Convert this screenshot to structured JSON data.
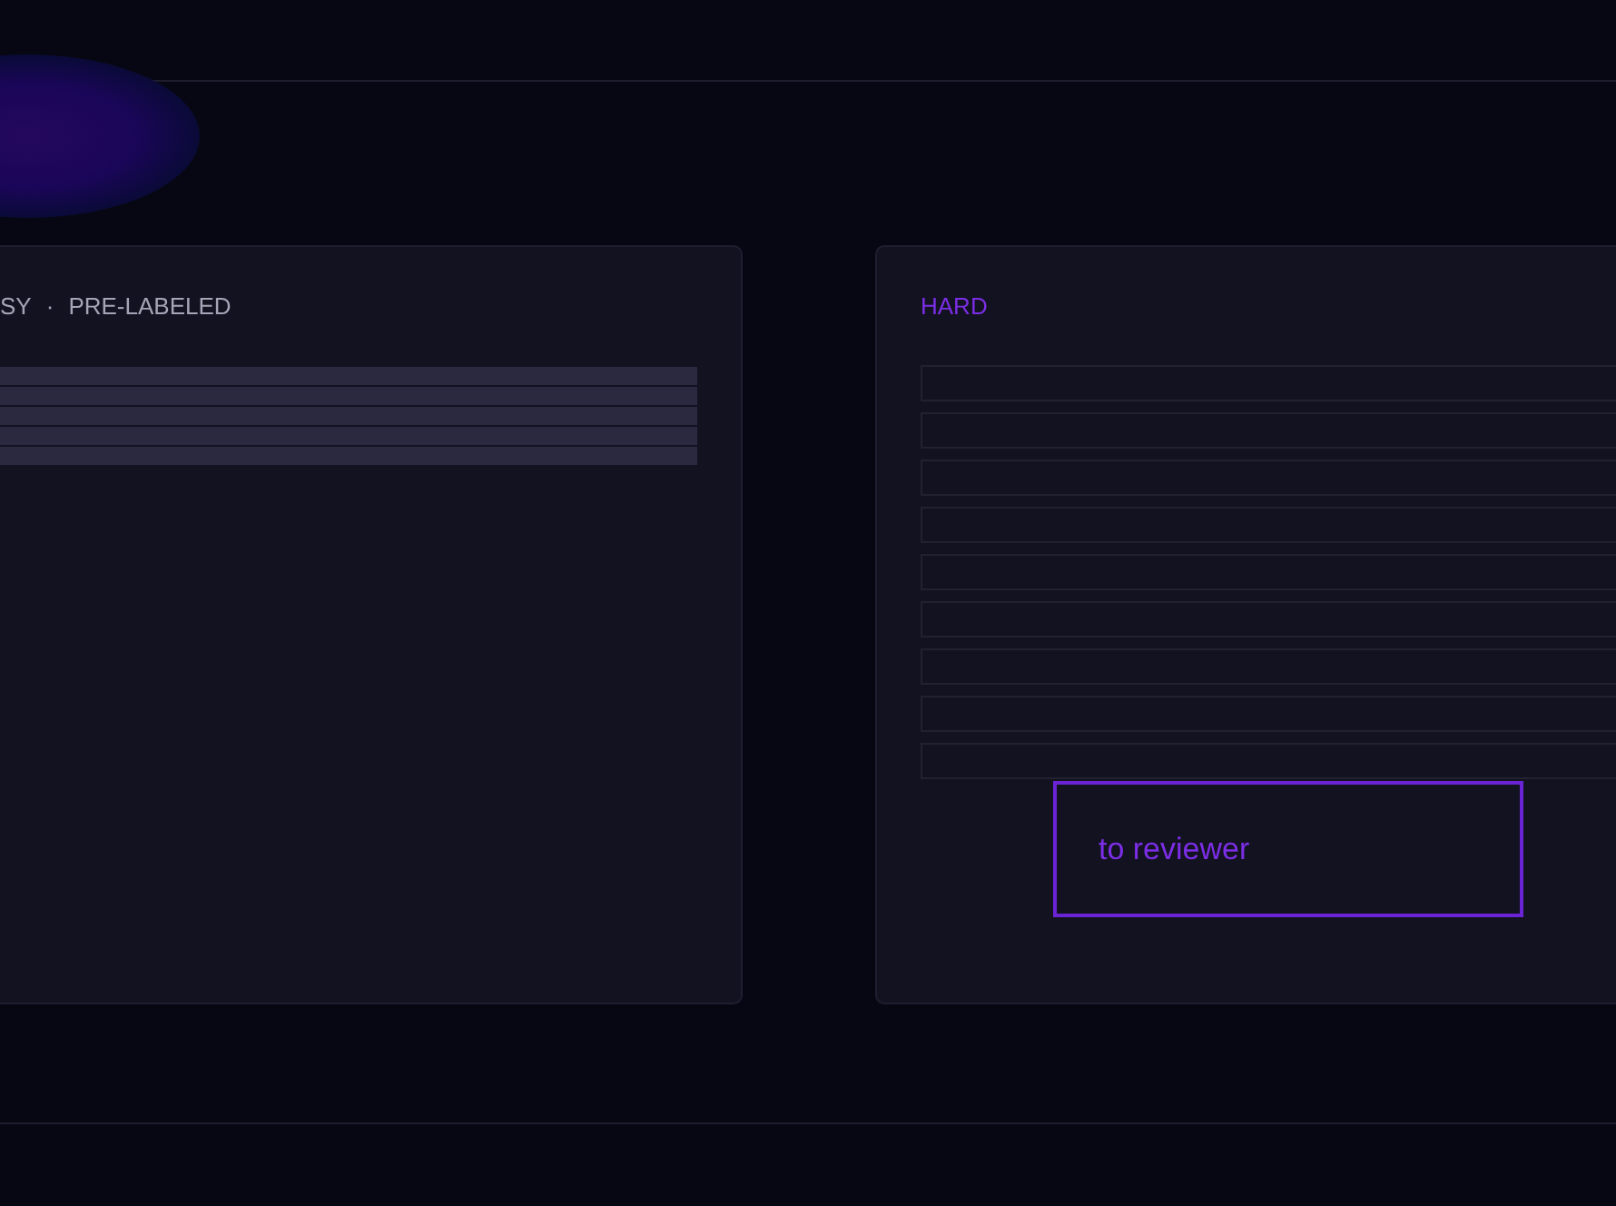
{
  "panels": [
    {
      "kind": "skeleton",
      "tags": [
        "SY",
        "PRE-LABELED"
      ],
      "separator": "·"
    },
    {
      "kind": "boxes",
      "tags": [
        "HARD"
      ],
      "button": "to reviewer"
    }
  ]
}
